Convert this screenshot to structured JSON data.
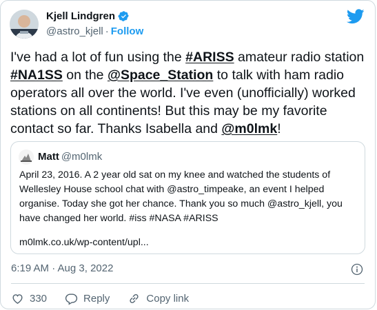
{
  "author": {
    "name": "Kjell Lindgren",
    "handle": "@astro_kjell",
    "separator": "·",
    "follow_label": "Follow"
  },
  "tweet": {
    "text_parts": [
      {
        "type": "text",
        "value": "I've had a lot of fun using the "
      },
      {
        "type": "link",
        "value": "#ARISS"
      },
      {
        "type": "text",
        "value": " amateur radio station "
      },
      {
        "type": "link",
        "value": "#NA1SS"
      },
      {
        "type": "text",
        "value": " on the "
      },
      {
        "type": "link",
        "value": "@Space_Station"
      },
      {
        "type": "text",
        "value": " to talk with ham radio operators all over the world. I've even (unofficially) worked stations on all continents! But this may be my favorite contact so far. Thanks Isabella and "
      },
      {
        "type": "link",
        "value": "@m0lmk"
      },
      {
        "type": "text",
        "value": "!"
      }
    ]
  },
  "quote": {
    "name": "Matt",
    "handle": "@m0lmk",
    "text": "April 23, 2016. A 2 year old sat on my knee and watched the students of Wellesley House school chat with @astro_timpeake, an event I helped organise. Today she got her chance. Thank you so much @astro_kjell, you have changed her world. #iss #NASA #ARISS",
    "link": "m0lmk.co.uk/wp-content/upl..."
  },
  "timestamp": "6:19 AM · Aug 3, 2022",
  "actions": {
    "like_count": "330",
    "reply_label": "Reply",
    "copy_label": "Copy link"
  },
  "colors": {
    "accent": "#1d9bf0",
    "secondary_text": "#536471",
    "border": "#cfd9de",
    "like_red": "#f91880"
  },
  "icons": [
    "verified-badge-icon",
    "twitter-bird-icon",
    "info-icon",
    "heart-icon",
    "reply-bubble-icon",
    "link-icon"
  ]
}
